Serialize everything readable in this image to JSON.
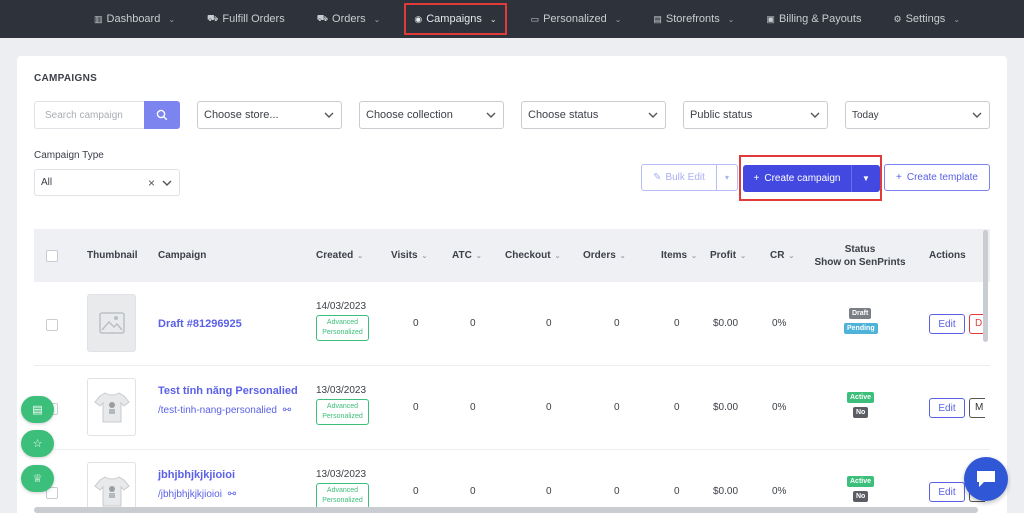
{
  "nav": {
    "items": [
      {
        "icon": "chart-bar-icon",
        "glyph": "▥",
        "label": "Dashboard",
        "chevron": true
      },
      {
        "icon": "cart-icon",
        "glyph": "⛟",
        "label": "Fulfill Orders",
        "chevron": false
      },
      {
        "icon": "cart-icon",
        "glyph": "⛟",
        "label": "Orders",
        "chevron": true
      },
      {
        "icon": "target-icon",
        "glyph": "◉",
        "label": "Campaigns",
        "chevron": true,
        "active": true
      },
      {
        "icon": "personalize-icon",
        "glyph": "▭",
        "label": "Personalized",
        "chevron": true
      },
      {
        "icon": "storefront-icon",
        "glyph": "▤",
        "label": "Storefronts",
        "chevron": true
      },
      {
        "icon": "billing-icon",
        "glyph": "▣",
        "label": "Billing & Payouts",
        "chevron": false
      },
      {
        "icon": "gear-icon",
        "glyph": "⚙",
        "label": "Settings",
        "chevron": true
      }
    ]
  },
  "page": {
    "title": "CAMPAIGNS"
  },
  "filters": {
    "search_placeholder": "Search campaign",
    "store": "Choose store...",
    "collection": "Choose collection",
    "status": "Choose status",
    "public_status": "Public status",
    "date": "Today"
  },
  "campaign_type": {
    "label": "Campaign Type",
    "value": "All",
    "clear": "×"
  },
  "actions": {
    "bulk_edit": "Bulk Edit",
    "create_campaign": "Create campaign",
    "create_template": "Create template",
    "plus": "+"
  },
  "table": {
    "headers": {
      "thumbnail": "Thumbnail",
      "campaign": "Campaign",
      "created": "Created",
      "visits": "Visits",
      "atc": "ATC",
      "checkout": "Checkout",
      "orders": "Orders",
      "items": "Items",
      "profit": "Profit",
      "cr": "CR",
      "status_line1": "Status",
      "status_line2": "Show on SenPrints",
      "actions": "Actions"
    },
    "rows": [
      {
        "name": "Draft #81296925",
        "slug": "",
        "created": "14/03/2023",
        "tag_line1": "Advanced",
        "tag_line2": "Personalized",
        "visits": "0",
        "atc": "0",
        "checkout": "0",
        "orders": "0",
        "items": "0",
        "profit": "$0.00",
        "cr": "0%",
        "status_top": "Draft",
        "status_bottom": "Pending",
        "edit": "Edit",
        "extra": "D"
      },
      {
        "name": "Test tính năng Personalied",
        "slug": "/test-tinh-nang-personalied",
        "created": "13/03/2023",
        "tag_line1": "Advanced",
        "tag_line2": "Personalized",
        "visits": "0",
        "atc": "0",
        "checkout": "0",
        "orders": "0",
        "items": "0",
        "profit": "$0.00",
        "cr": "0%",
        "status_top": "Active",
        "status_bottom": "No",
        "edit": "Edit",
        "extra": "M"
      },
      {
        "name": "jbhjbhjkjkjioioi",
        "slug": "/jbhjbhjkjkjioioi",
        "created": "13/03/2023",
        "tag_line1": "Advanced",
        "tag_line2": "Personalized",
        "visits": "0",
        "atc": "0",
        "checkout": "0",
        "orders": "0",
        "items": "0",
        "profit": "$0.00",
        "cr": "0%",
        "status_top": "Active",
        "status_bottom": "No",
        "edit": "Edit",
        "extra": "M"
      }
    ]
  },
  "colors": {
    "nav_bg": "#2e333b",
    "accent": "#4348e0",
    "link": "#5a61e6",
    "success": "#3cbf7a",
    "highlight": "#e03a3a"
  }
}
